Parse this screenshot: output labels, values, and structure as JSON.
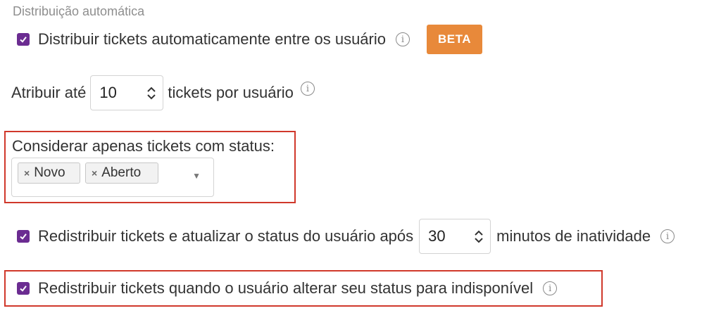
{
  "section_title": "Distribuição automática",
  "auto_distribute": {
    "label": "Distribuir tickets automaticamente entre os usuário",
    "checked": true,
    "info_icon": "info-icon",
    "badge": "BETA"
  },
  "assign": {
    "prefix": "Atribuir até",
    "value": "10",
    "suffix": "tickets por usuário",
    "info_icon": "info-icon"
  },
  "status_filter": {
    "label": "Considerar apenas tickets com status:",
    "tags": [
      {
        "remove": "×",
        "label": "Novo"
      },
      {
        "remove": "×",
        "label": "Aberto"
      }
    ],
    "dropdown_icon": "▼"
  },
  "inactivity": {
    "label": "Redistribuir tickets e atualizar o status do usuário após",
    "checked": true,
    "value": "30",
    "suffix": "minutos de inatividade",
    "info_icon": "info-icon"
  },
  "unavailable": {
    "label": "Redistribuir tickets quando o usuário alterar seu status para indisponível",
    "checked": true,
    "info_icon": "info-icon"
  },
  "colors": {
    "checkbox": "#6b2c91",
    "beta": "#e8893a",
    "highlight": "#d0382b"
  }
}
